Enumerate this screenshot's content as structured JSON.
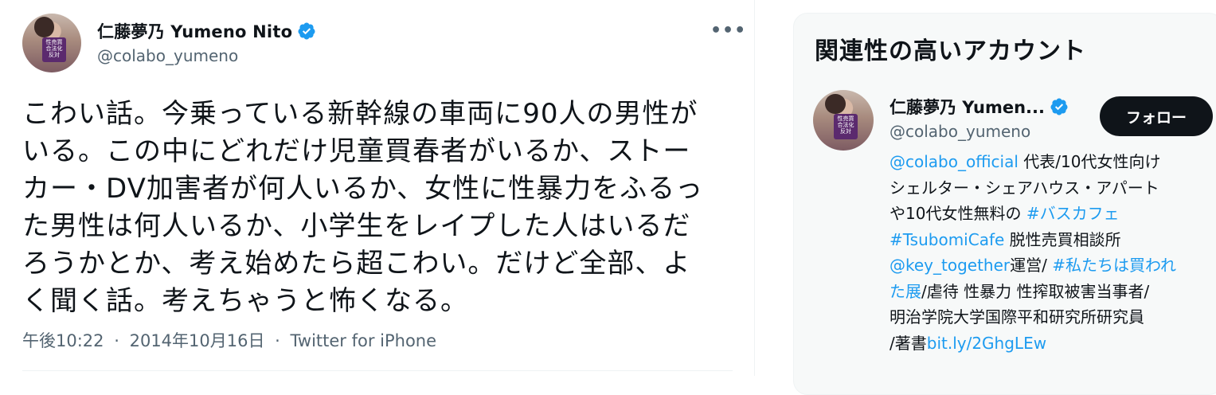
{
  "tweet": {
    "display_name": "仁藤夢乃 Yumeno Nito",
    "handle": "@colabo_yumeno",
    "more_icon": "•••",
    "text": "こわい話。今乗っている新幹線の車両に90人の男性が\nいる。この中にどれだけ児童買春者がいるか、ストー\nカー・DV加害者が何人いるか、女性に性暴力をふるっ\nた男性は何人いるか、小学生をレイプした人はいるだ\nろうかとか、考え始めたら超こわい。だけど全部、よ\nく聞く話。考えちゃうと怖くなる。",
    "time": "午後10:22",
    "date": "2014年10月16日",
    "source": "Twitter for iPhone",
    "separator": "·",
    "avatar_sign_text": "性売買\n合法化\n反対"
  },
  "related": {
    "title": "関連性の高いアカウント",
    "display_name": "仁藤夢乃 Yumen...",
    "handle": "@colabo_yumeno",
    "follow_label": "フォロー",
    "bio": {
      "l1_link": "@colabo_official",
      "l1_text": " 代表/10代女性向け",
      "l2_text": "シェルター・シェアハウス・アパート",
      "l3_text": "や10代女性無料の ",
      "l3_link": "#バスカフェ",
      "l4_link": "#TsubomiCafe",
      "l4_text": " 脱性売買相談所",
      "l5_link": "@key_together",
      "l5_text": "運営/ ",
      "l5_link2": "#私たちは買われ",
      "l6_link": "た展",
      "l6_text": "/虐待 性暴力 性搾取被害当事者/",
      "l7_text": "明治学院大学国際平和研究所研究員",
      "l8_text": "/著書",
      "l8_link": "bit.ly/2GhgLEw"
    }
  },
  "colors": {
    "verified": "#1d9bf0",
    "link": "#1d9bf0",
    "follow_button": "#0f1419",
    "secondary_text": "#536471"
  }
}
